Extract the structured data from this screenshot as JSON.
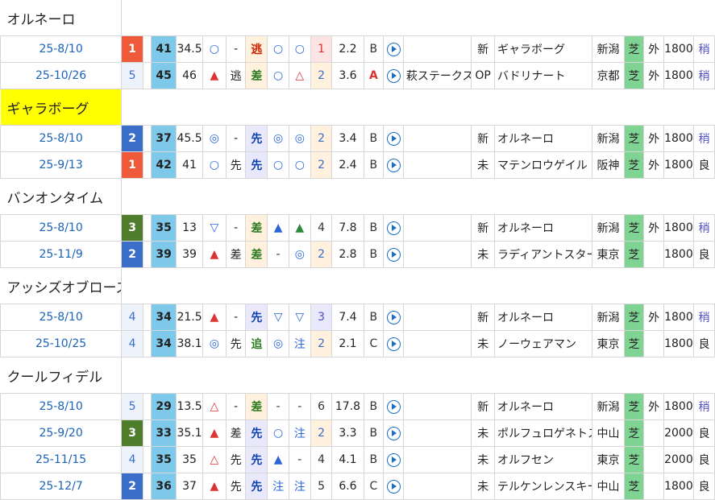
{
  "colors": {
    "fin_1": "#ef5a3a",
    "fin_2": "#3a6ec8",
    "fin_3": "#4e7d2c",
    "fin_other_bg": "#eef2fb",
    "fin_other_fg": "#3a6ec8",
    "number_bg": "#7ec8ea",
    "surface_bg": "#7fd493",
    "pos_nige": "#cc2200",
    "pos_sen": "#1040b0",
    "pos_sa": "#2a7a20",
    "rank_bg_1": "#fde4e4",
    "rank_bg_2": "#fff1dd",
    "rank_bg_3": "#e9e9fb",
    "up_red": "#dd3333",
    "up_blue": "#2a66d8",
    "up_green": "#2a8a3a",
    "cond_blue": "#5050c0"
  },
  "horses": [
    {
      "name": "オルネーロ",
      "highlighted": false,
      "races": [
        {
          "date": "25-8/10",
          "finish": "1",
          "index": "41",
          "pct": "34.5",
          "m1": "○",
          "m2": "-",
          "pos": "逃",
          "m3": "○",
          "m4": "○",
          "rank": "1",
          "odds": "2.2",
          "grade": "B",
          "race_name": "",
          "class": "新",
          "rival": "ギャラボーグ",
          "venue": "新潟",
          "surface": "芝",
          "course": "外",
          "distance": "1800",
          "cond": "稍"
        },
        {
          "date": "25-10/26",
          "finish": "5",
          "index": "45",
          "pct": "46",
          "m1": "▲",
          "m2": "逃",
          "pos": "差",
          "m3": "○",
          "m4": "△",
          "rank": "2",
          "odds": "3.6",
          "grade": "A",
          "race_name": "萩ステークス",
          "class": "OP",
          "rival": "バドリナート",
          "venue": "京都",
          "surface": "芝",
          "course": "外",
          "distance": "1800",
          "cond": "稍"
        }
      ]
    },
    {
      "name": "ギャラボーグ",
      "highlighted": true,
      "races": [
        {
          "date": "25-8/10",
          "finish": "2",
          "index": "37",
          "pct": "45.5",
          "m1": "◎",
          "m2": "-",
          "pos": "先",
          "m3": "◎",
          "m4": "◎",
          "rank": "2",
          "odds": "3.4",
          "grade": "B",
          "race_name": "",
          "class": "新",
          "rival": "オルネーロ",
          "venue": "新潟",
          "surface": "芝",
          "course": "外",
          "distance": "1800",
          "cond": "稍"
        },
        {
          "date": "25-9/13",
          "finish": "1",
          "index": "42",
          "pct": "41",
          "m1": "○",
          "m2": "先",
          "pos": "先",
          "m3": "○",
          "m4": "○",
          "rank": "2",
          "odds": "2.4",
          "grade": "B",
          "race_name": "",
          "class": "未",
          "rival": "マテンロウゲイル",
          "venue": "阪神",
          "surface": "芝",
          "course": "外",
          "distance": "1800",
          "cond": "良"
        }
      ]
    },
    {
      "name": "バンオンタイム",
      "highlighted": false,
      "races": [
        {
          "date": "25-8/10",
          "finish": "3",
          "index": "35",
          "pct": "13",
          "m1": "▽",
          "m2": "-",
          "pos": "差",
          "m3": "▲",
          "m4": "▲",
          "rank": "4",
          "odds": "7.8",
          "grade": "B",
          "race_name": "",
          "class": "新",
          "rival": "オルネーロ",
          "venue": "新潟",
          "surface": "芝",
          "course": "外",
          "distance": "1800",
          "cond": "稍"
        },
        {
          "date": "25-11/9",
          "finish": "2",
          "index": "39",
          "pct": "39",
          "m1": "▲",
          "m2": "差",
          "pos": "差",
          "m3": "-",
          "m4": "◎",
          "rank": "2",
          "odds": "2.8",
          "grade": "B",
          "race_name": "",
          "class": "未",
          "rival": "ラディアントスター",
          "venue": "東京",
          "surface": "芝",
          "course": "",
          "distance": "1800",
          "cond": "良"
        }
      ]
    },
    {
      "name": "アッシズオブローズ",
      "highlighted": false,
      "races": [
        {
          "date": "25-8/10",
          "finish": "4",
          "index": "34",
          "pct": "21.5",
          "m1": "▲",
          "m2": "-",
          "pos": "先",
          "m3": "▽",
          "m4": "▽",
          "rank": "3",
          "odds": "7.4",
          "grade": "B",
          "race_name": "",
          "class": "新",
          "rival": "オルネーロ",
          "venue": "新潟",
          "surface": "芝",
          "course": "外",
          "distance": "1800",
          "cond": "稍"
        },
        {
          "date": "25-10/25",
          "finish": "4",
          "index": "34",
          "pct": "38.1",
          "m1": "◎",
          "m2": "先",
          "pos": "追",
          "m3": "◎",
          "m4": "注",
          "rank": "2",
          "odds": "2.1",
          "grade": "C",
          "race_name": "",
          "class": "未",
          "rival": "ノーウェアマン",
          "venue": "東京",
          "surface": "芝",
          "course": "",
          "distance": "1800",
          "cond": "良"
        }
      ]
    },
    {
      "name": "クールフィデル",
      "highlighted": false,
      "races": [
        {
          "date": "25-8/10",
          "finish": "5",
          "index": "29",
          "pct": "13.5",
          "m1": "△",
          "m2": "-",
          "pos": "差",
          "m3": "-",
          "m4": "-",
          "rank": "6",
          "odds": "17.8",
          "grade": "B",
          "race_name": "",
          "class": "新",
          "rival": "オルネーロ",
          "venue": "新潟",
          "surface": "芝",
          "course": "外",
          "distance": "1800",
          "cond": "稍"
        },
        {
          "date": "25-9/20",
          "finish": "3",
          "index": "33",
          "pct": "35.1",
          "m1": "▲",
          "m2": "差",
          "pos": "先",
          "m3": "○",
          "m4": "注",
          "rank": "2",
          "odds": "3.3",
          "grade": "B",
          "race_name": "",
          "class": "未",
          "rival": "ポルフュロゲネトス",
          "venue": "中山",
          "surface": "芝",
          "course": "",
          "distance": "2000",
          "cond": "良"
        },
        {
          "date": "25-11/15",
          "finish": "4",
          "index": "35",
          "pct": "35",
          "m1": "△",
          "m2": "先",
          "pos": "先",
          "m3": "▲",
          "m4": "-",
          "rank": "4",
          "odds": "4.1",
          "grade": "B",
          "race_name": "",
          "class": "未",
          "rival": "オルフセン",
          "venue": "東京",
          "surface": "芝",
          "course": "",
          "distance": "2000",
          "cond": "良"
        },
        {
          "date": "25-12/7",
          "finish": "2",
          "index": "36",
          "pct": "37",
          "m1": "▲",
          "m2": "先",
          "pos": "先",
          "m3": "注",
          "m4": "注",
          "rank": "5",
          "odds": "6.6",
          "grade": "C",
          "race_name": "",
          "class": "未",
          "rival": "テルケンレンスキー",
          "venue": "中山",
          "surface": "芝",
          "course": "",
          "distance": "1800",
          "cond": "良"
        }
      ]
    }
  ]
}
